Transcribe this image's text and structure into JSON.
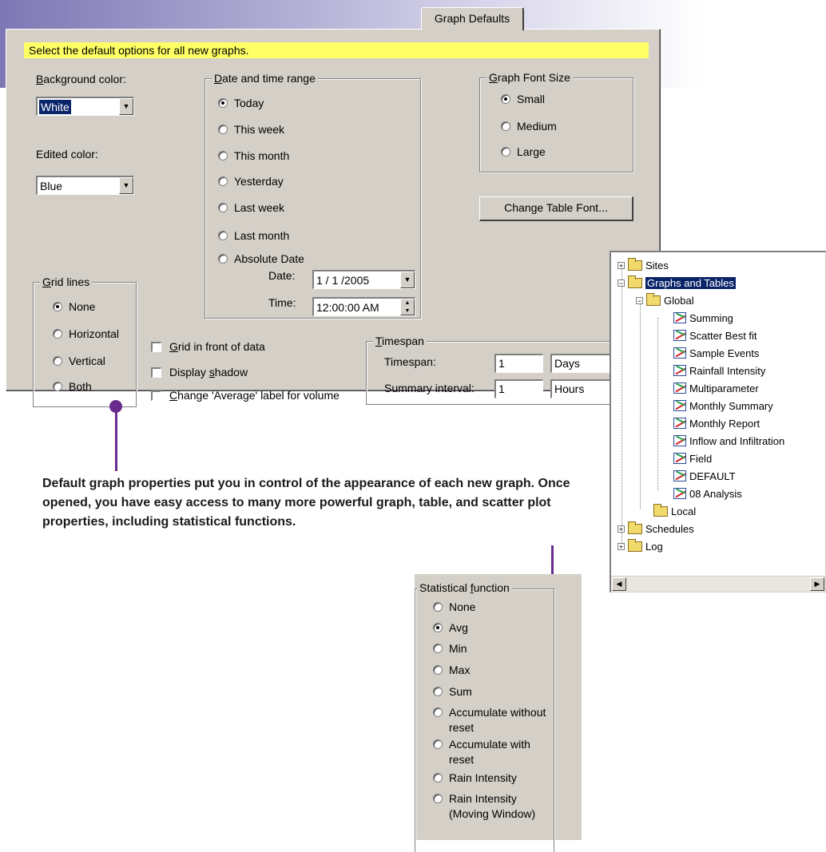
{
  "tab": {
    "label": "Graph Defaults"
  },
  "instruction": "Select the default options for all new graphs.",
  "background_color": {
    "label_pre": "",
    "label_u": "B",
    "label_post": "ackground color:",
    "value": "White"
  },
  "edited_color": {
    "label": "Edited color:",
    "value": "Blue"
  },
  "date_range": {
    "legend_u": "D",
    "legend_post": "ate and time range",
    "options": [
      "Today",
      "This week",
      "This month",
      "Yesterday",
      "Last week",
      "Last month",
      "Absolute Date"
    ],
    "selected": "Today",
    "date_label": "Date:",
    "date_value": "1 / 1 /2005",
    "time_label": "Time:",
    "time_value": "12:00:00 AM"
  },
  "font_size": {
    "legend_u": "G",
    "legend_post": "raph Font Size",
    "options": [
      "Small",
      "Medium",
      "Large"
    ],
    "selected": "Small"
  },
  "change_table_font": "Change Table Font...",
  "grid_lines": {
    "legend_u": "G",
    "legend_post": "rid lines",
    "options": [
      "None",
      "Horizontal",
      "Vertical",
      "Both"
    ],
    "selected": "None"
  },
  "checks": [
    {
      "pre": "",
      "u": "G",
      "post": "rid in front of data"
    },
    {
      "pre": "Display ",
      "u": "s",
      "post": "hadow"
    },
    {
      "pre": "",
      "u": "C",
      "post": "hange 'Average' label for volume"
    }
  ],
  "timespan": {
    "legend_u": "T",
    "legend_post": "imespan",
    "timespan_label": "Timespan:",
    "timespan_value": "1",
    "timespan_unit": "Days",
    "interval_label": "Summary interval:",
    "interval_value": "1",
    "interval_unit": "Hours"
  },
  "caption": "Default graph properties put you in control of the appearance of each new graph. Once opened, you have easy access to many more powerful graph, table, and scatter plot properties, including statistical functions.",
  "tree": {
    "sites": "Sites",
    "graphs_tables": "Graphs and Tables",
    "global": "Global",
    "items": [
      "Summing",
      "Scatter Best fit",
      "Sample Events",
      "Rainfall Intensity",
      "Multiparameter",
      "Monthly Summary",
      "Monthly Report",
      "Inflow and Infiltration",
      "Field",
      "DEFAULT",
      "08 Analysis"
    ],
    "local": "Local",
    "schedules": "Schedules",
    "log": "Log"
  },
  "statistical": {
    "legend_pre": "Statistical ",
    "legend_u": "f",
    "legend_post": "unction",
    "options": [
      "None",
      "Avg",
      "Min",
      "Max",
      "Sum",
      "Accumulate without",
      "reset",
      "Accumulate with",
      "reset",
      "Rain Intensity",
      "Rain Intensity",
      "(Moving Window)"
    ],
    "selected": "Avg"
  }
}
